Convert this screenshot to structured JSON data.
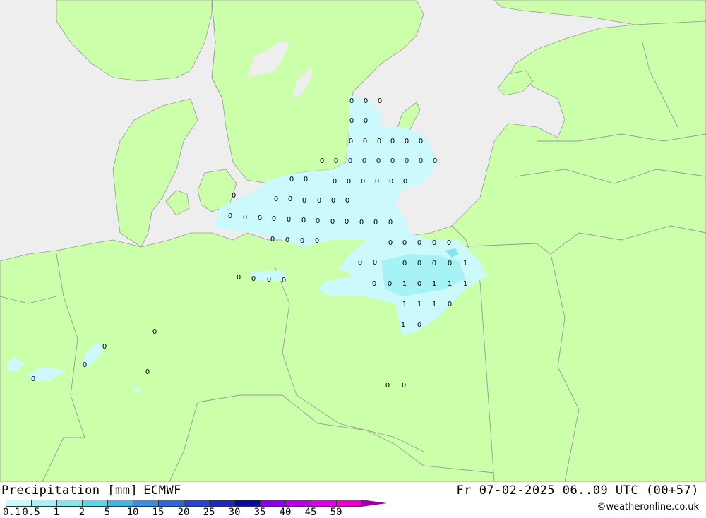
{
  "map": {
    "colors": {
      "land": "#ccffaa",
      "sea": "#eeeeee",
      "border": "#999999",
      "precip_light": "#ccfafc",
      "precip_mid": "#a6f2f5",
      "precip_heavy": "#84e6ec"
    },
    "point_values": [
      "0",
      "0",
      "0",
      "0",
      "0",
      "0",
      "0",
      "0",
      "0",
      "0",
      "0",
      "0",
      "0",
      "0",
      "0",
      "0",
      "0",
      "0",
      "0",
      "0",
      "0",
      "0",
      "0",
      "0",
      "0",
      "0",
      "0",
      "0",
      "0",
      "0",
      "0",
      "0",
      "0",
      "0",
      "0",
      "0",
      "0",
      "0",
      "0",
      "0",
      "0",
      "0",
      "0",
      "0",
      "0",
      "0",
      "0",
      "0",
      "0",
      "0",
      "0",
      "0",
      "0",
      "0",
      "0",
      "0",
      "0",
      "0",
      "0",
      "0",
      "0",
      "0",
      "1",
      "0",
      "0",
      "1",
      "0",
      "1",
      "1",
      "1",
      "1",
      "1",
      "1",
      "0",
      "1",
      "0",
      "0",
      "0",
      "0",
      "0",
      "0",
      "0",
      "0",
      "0",
      "0",
      "0",
      "0",
      "0",
      "0",
      "0",
      "0",
      "0",
      "0"
    ]
  },
  "footer": {
    "title": "Precipitation [mm]",
    "model": "ECMWF",
    "valid_time": "Fr 07-02-2025 06..09 UTC (00+57)",
    "credit": "©weatheronline.co.uk"
  },
  "legend": {
    "colors": [
      "#ccfafc",
      "#a6f2f5",
      "#84e6ec",
      "#5fd4e4",
      "#46b4e0",
      "#3c8cd8",
      "#3264d2",
      "#2846c8",
      "#1e28b4",
      "#0a0a96",
      "#8c00e6",
      "#b400e6",
      "#dc00e6",
      "#e600c8",
      "#c000aa"
    ],
    "labels": [
      "0.1",
      "0.5",
      "1",
      "2",
      "5",
      "10",
      "15",
      "20",
      "25",
      "30",
      "35",
      "40",
      "45",
      "50"
    ]
  }
}
